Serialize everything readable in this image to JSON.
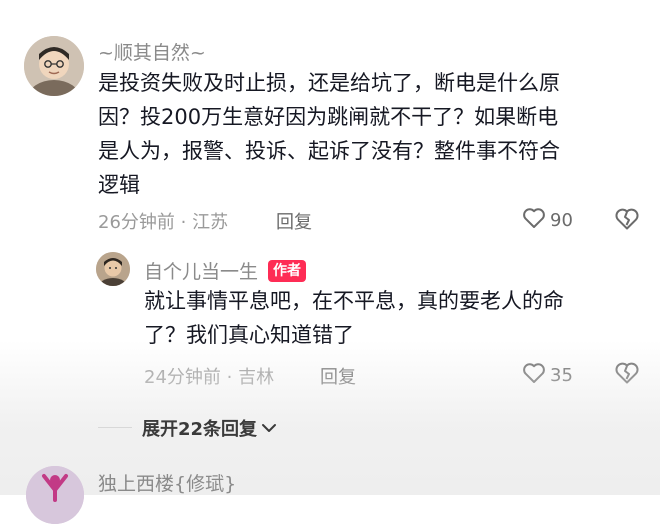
{
  "comment": {
    "username": "~顺其自然~",
    "lines": [
      "是投资失败及时止损，还是给坑了，断电是什么原",
      "因？投200万生意好因为跳闸就不干了？如果断电",
      "是人为，报警、投诉、起诉了没有？整件事不符合",
      "逻辑"
    ],
    "meta": "26分钟前 · 江苏",
    "reply_label": "回复",
    "likes": "90"
  },
  "reply": {
    "username": "自个儿当一生",
    "badge": "作者",
    "lines": [
      "就让事情平息吧，在不平息，真的要老人的命",
      "了？我们真心知道错了"
    ],
    "meta": "24分钟前 · 吉林",
    "reply_label": "回复",
    "likes": "35"
  },
  "expand_label": "展开22条回复",
  "next_comment": {
    "username": "独上西楼{修珷}"
  },
  "colors": {
    "badge": "#fe2c55",
    "text": "#161823",
    "meta": "#9a9a9a"
  },
  "icons": {
    "like": "heart-outline-icon",
    "dislike": "broken-heart-icon",
    "expand": "chevron-down-icon"
  }
}
